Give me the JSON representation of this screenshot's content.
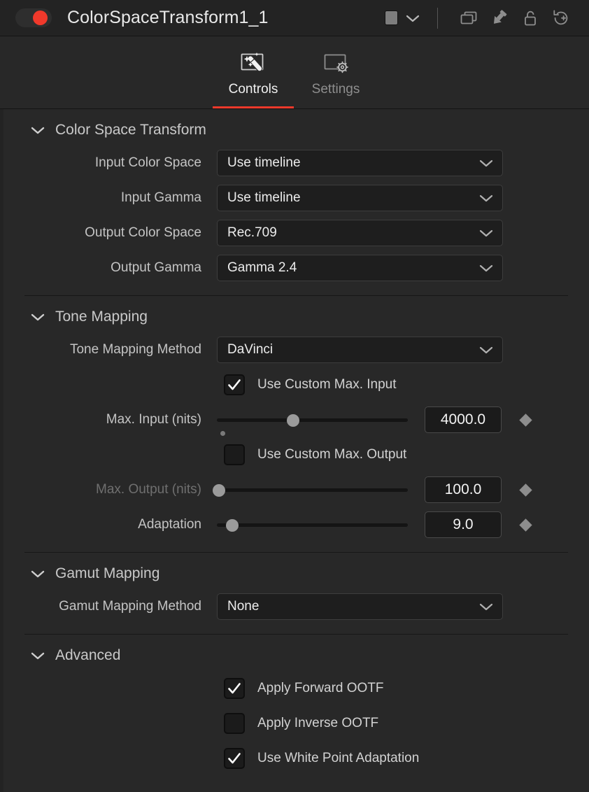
{
  "titlebar": {
    "node_name": "ColorSpaceTransform1_1",
    "toggle_state": "on",
    "toggle_color": "#f0392b",
    "swatch_color": "#7d7d7d",
    "icons": [
      {
        "name": "swatch-chevron-icon",
        "label": "chevron-down-icon"
      },
      {
        "name": "duplicate-icon",
        "label": "copy-windows-icon"
      },
      {
        "name": "pin-icon",
        "label": "pin-icon"
      },
      {
        "name": "lock-icon",
        "label": "unlocked-padlock-icon"
      },
      {
        "name": "reset-icon",
        "label": "reset-version-icon"
      }
    ]
  },
  "tabs": [
    {
      "label": "Controls",
      "icon": "magic-wand-icon",
      "active": true
    },
    {
      "label": "Settings",
      "icon": "gear-screen-icon",
      "active": false
    }
  ],
  "accent_color": "#f0392b",
  "sections": {
    "color_space_transform": {
      "title": "Color Space Transform",
      "expanded": true,
      "rows": [
        {
          "label": "Input Color Space",
          "value": "Use timeline"
        },
        {
          "label": "Input Gamma",
          "value": "Use timeline"
        },
        {
          "label": "Output Color Space",
          "value": "Rec.709"
        },
        {
          "label": "Output Gamma",
          "value": "Gamma 2.4"
        }
      ]
    },
    "tone_mapping": {
      "title": "Tone Mapping",
      "expanded": true,
      "method": {
        "label": "Tone Mapping Method",
        "value": "DaVinci"
      },
      "use_custom_max_input": {
        "label": "Use Custom Max. Input",
        "checked": true
      },
      "max_input": {
        "label": "Max. Input (nits)",
        "value": "4000.0",
        "slider_percent": 40,
        "default_marker_percent": 3,
        "enabled": true
      },
      "use_custom_max_output": {
        "label": "Use Custom Max. Output",
        "checked": false
      },
      "max_output": {
        "label": "Max. Output (nits)",
        "value": "100.0",
        "slider_percent": 1,
        "enabled": false
      },
      "adaptation": {
        "label": "Adaptation",
        "value": "9.0",
        "slider_percent": 8,
        "enabled": true
      }
    },
    "gamut_mapping": {
      "title": "Gamut Mapping",
      "expanded": true,
      "method": {
        "label": "Gamut Mapping Method",
        "value": "None"
      }
    },
    "advanced": {
      "title": "Advanced",
      "expanded": true,
      "checkboxes": [
        {
          "label": "Apply Forward OOTF",
          "checked": true
        },
        {
          "label": "Apply Inverse OOTF",
          "checked": false
        },
        {
          "label": "Use White Point Adaptation",
          "checked": true
        }
      ]
    }
  }
}
